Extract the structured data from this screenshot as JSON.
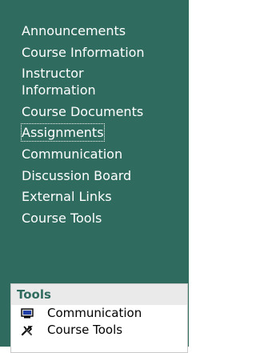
{
  "nav": {
    "items": [
      {
        "label": "Announcements"
      },
      {
        "label": "Course Information"
      },
      {
        "label": "Instructor Information"
      },
      {
        "label": "Course Documents"
      },
      {
        "label": "Assignments"
      },
      {
        "label": "Communication"
      },
      {
        "label": "Discussion Board"
      },
      {
        "label": "External Links"
      },
      {
        "label": "Course Tools"
      }
    ]
  },
  "tools": {
    "title": "Tools",
    "items": [
      {
        "label": "Communication",
        "icon": "monitor-icon"
      },
      {
        "label": "Course Tools",
        "icon": "tools-icon"
      }
    ]
  },
  "colors": {
    "panel": "#2f6b5f",
    "text": "#ffffff",
    "tools_title": "#2f6b5f"
  }
}
